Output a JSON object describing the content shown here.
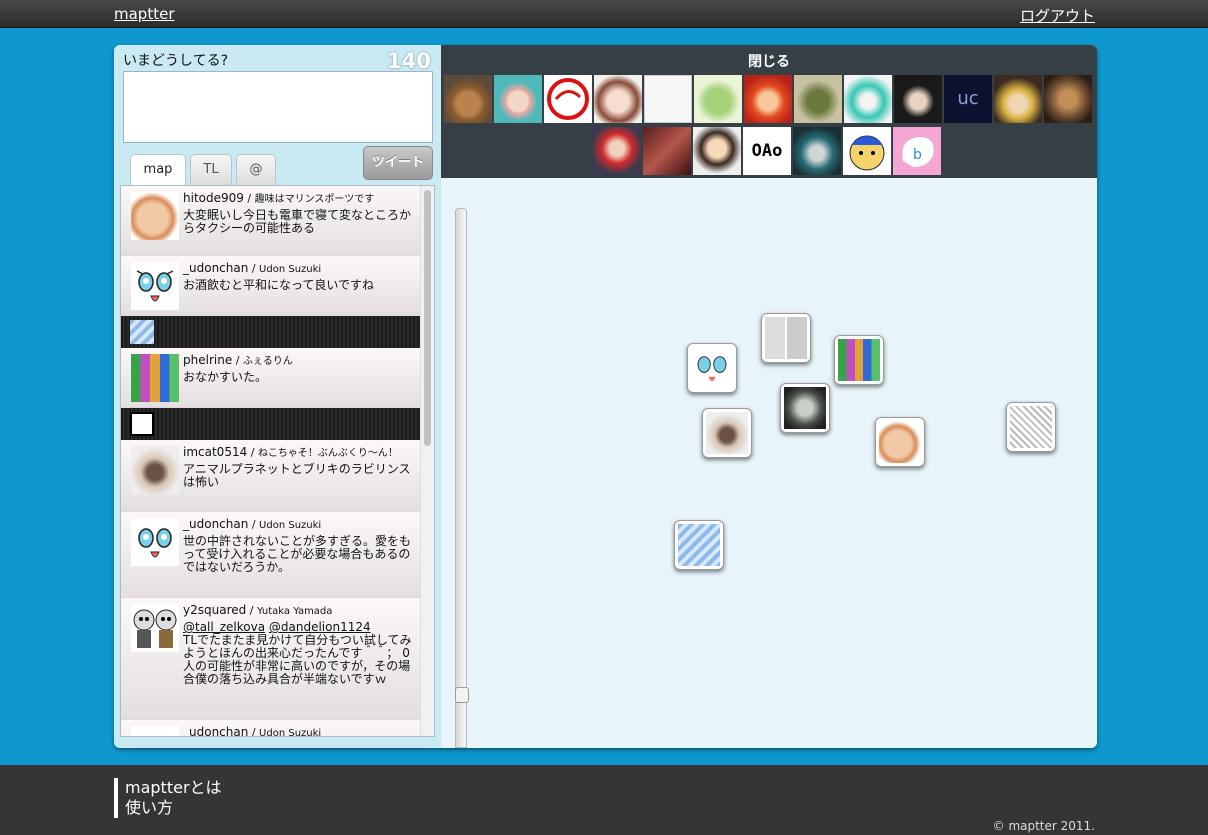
{
  "header": {
    "brand": "maptter",
    "logout": "ログアウト"
  },
  "status": {
    "prompt": "いまどうしてる?",
    "remaining": "140",
    "text": "",
    "tweet_button": "ツイート"
  },
  "tabs": [
    {
      "label": "map",
      "active": true
    },
    {
      "label": "TL"
    },
    {
      "label": "@"
    }
  ],
  "timeline": [
    {
      "user": "hitode909",
      "name": "趣味はマリンスポーツです",
      "text": "大変眠いし今日も電車で寝て変なところからタクシーの可能性ある",
      "avatar": "bread"
    },
    {
      "user": "_udonchan",
      "name": "Udon Suzuki",
      "text": "お酒飲むと平和になって良いですね",
      "avatar": "anime-face"
    },
    {
      "user": "phelrine",
      "name": "ふぇるりん",
      "text": "おなかすいた。",
      "avatar": "pixel-art"
    },
    {
      "user": "imcat0514",
      "name": "ねこちゃそ！ぶんぶくり〜ん！",
      "text": "アニマルプラネットとブリキのラビリンスは怖い",
      "avatar": "siamese-cat"
    },
    {
      "user": "_udonchan",
      "name": "Udon Suzuki",
      "text": "世の中許されないことが多すぎる。愛をもって受け入れることが必要な場合もあるのではないだろうか。",
      "avatar": "anime-face"
    },
    {
      "user": "y2squared",
      "name": "Yutaka Yamada",
      "mentions": [
        "@tall_zelkova",
        "@dandelion1124"
      ],
      "text": "TLでたまたま見かけて自分もつい試してみようとほんの出来心だったんです＾＾； 0人の可能性が非常に高いのですが，その場合僕の落ち込み具合が半端ないですｗ",
      "avatar": "cat-pair"
    },
    {
      "user": "_udonchan",
      "name": "Udon Suzuki",
      "text": "",
      "avatar": "anime-face"
    }
  ],
  "follow_panel": {
    "close_label": "閉じる"
  },
  "colors": {
    "background": "#0e98cf",
    "topbar": "#2b2b2b",
    "map": "#e7f4fa",
    "footer": "#353535"
  },
  "zoom": {
    "level_fraction": 0.05
  },
  "footer": {
    "about": "maptterとは",
    "howto": "使い方",
    "copyright": "© maptter 2011."
  }
}
